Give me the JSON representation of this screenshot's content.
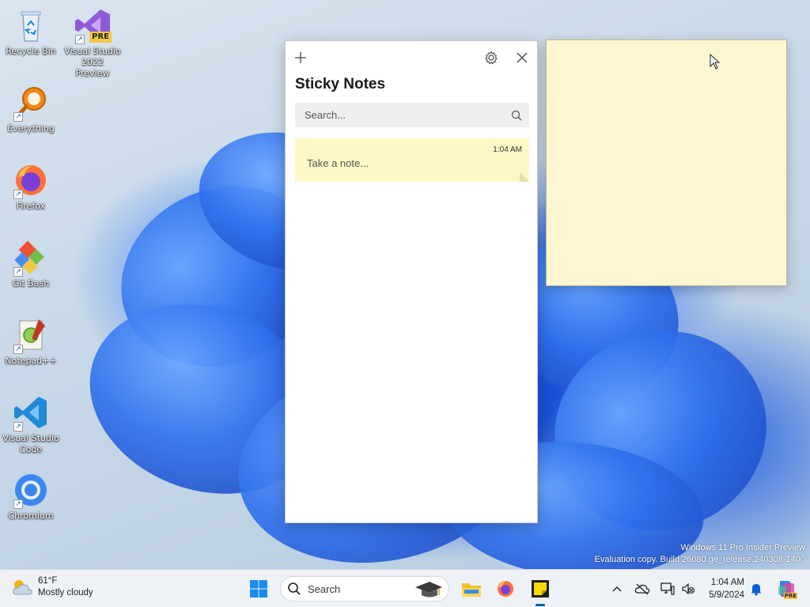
{
  "desktop": {
    "icons": [
      {
        "label": "Recycle Bin"
      },
      {
        "label": "Visual Studio 2022 Preview",
        "badge": "PRE"
      },
      {
        "label": "Everything"
      },
      {
        "label": "Firefox"
      },
      {
        "label": "Git Bash"
      },
      {
        "label": "Notepad++"
      },
      {
        "label": "Visual Studio Code"
      },
      {
        "label": "Chromium"
      }
    ],
    "watermark": {
      "line1": "Windows 11 Pro Insider Preview",
      "line2": "Evaluation copy. Build 26080.ge_release.240308-1400"
    }
  },
  "notes_window": {
    "title": "Sticky Notes",
    "search_placeholder": "Search...",
    "notes": [
      {
        "time": "1:04 AM",
        "text": "Take a note..."
      }
    ],
    "colors": {
      "note": "#fdf7c5",
      "sticky": "#fdf7d1"
    }
  },
  "taskbar": {
    "weather": {
      "temp": "61°F",
      "condition": "Mostly cloudy"
    },
    "search_label": "Search",
    "clock": {
      "time": "1:04 AM",
      "date": "5/9/2024"
    },
    "accent": "#005fb8"
  }
}
